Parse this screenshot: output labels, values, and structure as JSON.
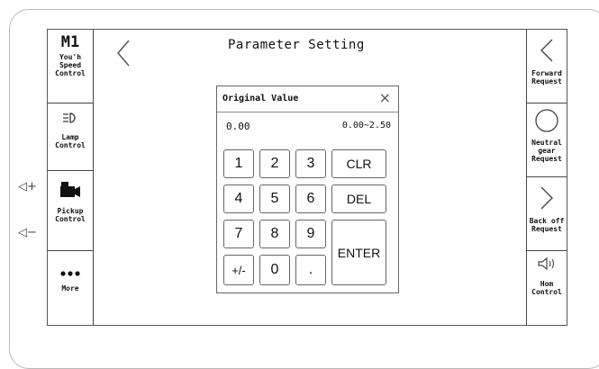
{
  "screen": {
    "title": "Parameter Setting"
  },
  "left_panel": [
    {
      "icon": "m1-icon",
      "icon_text": "M1",
      "label": [
        "You'h",
        "Speed",
        "Control"
      ]
    },
    {
      "icon": "lamp-icon",
      "label": [
        "Lamp",
        "Control"
      ]
    },
    {
      "icon": "pickup-camera-icon",
      "label": [
        "Pickup",
        "Control"
      ]
    },
    {
      "icon": "more-dots-icon",
      "label": [
        "More"
      ]
    }
  ],
  "right_panel": [
    {
      "icon": "chevron-left-icon",
      "label": [
        "Forward",
        "Request"
      ]
    },
    {
      "icon": "circle-icon",
      "label": [
        "Neutral",
        "gear",
        "Request"
      ]
    },
    {
      "icon": "chevron-right-icon",
      "label": [
        "Back off",
        "Request"
      ]
    },
    {
      "icon": "horn-icon",
      "label": [
        "Hom",
        "Control"
      ]
    }
  ],
  "volume": {
    "up": "◁+",
    "down": "◁−"
  },
  "dialog": {
    "title": "Original Value",
    "close": "×",
    "current_value": "0.00",
    "range": "0.00~2.50",
    "keys": {
      "k1": "1",
      "k2": "2",
      "k3": "3",
      "clr": "CLR",
      "k4": "4",
      "k5": "5",
      "k6": "6",
      "del": "DEL",
      "k7": "7",
      "k8": "8",
      "k9": "9",
      "enter": "ENTER",
      "sign": "+/-",
      "k0": "0",
      "dot": "."
    }
  }
}
